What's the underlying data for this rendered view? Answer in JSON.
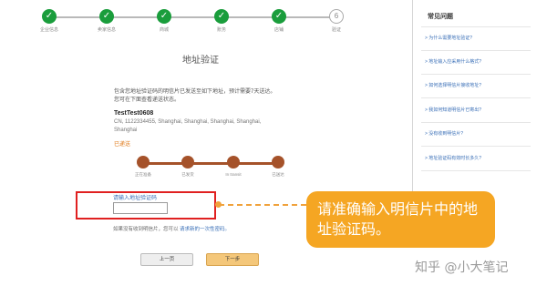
{
  "stepper": {
    "steps": [
      {
        "label": "企业信息",
        "state": "done"
      },
      {
        "label": "卖家信息",
        "state": "done"
      },
      {
        "label": "商城",
        "state": "done"
      },
      {
        "label": "账务",
        "state": "done"
      },
      {
        "label": "店铺",
        "state": "done"
      },
      {
        "label": "验证",
        "state": "current",
        "number": "6"
      }
    ],
    "check_glyph": "✓"
  },
  "main": {
    "title": "地址验证",
    "description": "包含您地址验证码的明信片已发送至如下地址，预计需要7天送达。您可在下面查看递送状态。",
    "address_name": "TestTest0608",
    "address_line": "CN, 1122334455, Shanghai, Shanghai, Shanghai, Shanghai, Shanghai",
    "status": "已递送",
    "tracker": [
      "正在准备",
      "已发货",
      "In transit",
      "已送达"
    ],
    "input_label": "请输入地址验证码",
    "input_value": "",
    "no_code_prefix": "如果没有收到明信片，您可以",
    "no_code_link": "请求新的一次性密码。",
    "prev_button": "上一页",
    "next_button": "下一步"
  },
  "callout": {
    "text": "请准确输入明信片中的地址验证码。"
  },
  "sidebar": {
    "title": "常见问题",
    "items": [
      "> 为什么需要地址验证?",
      "> 地址输入应采用什么格式?",
      "> 如何选择明信片接收地址?",
      "> 我如何知道明信片已寄出?",
      "> 没有收到明信片?",
      "> 地址验证码有效时长多久?"
    ]
  },
  "watermark": "知乎 @小大笔记",
  "colors": {
    "done_green": "#1a9d3c",
    "tracker_brown": "#a5522a",
    "highlight_red": "#e02020",
    "callout_orange": "#f5a623",
    "link_blue": "#3a6fb7"
  }
}
